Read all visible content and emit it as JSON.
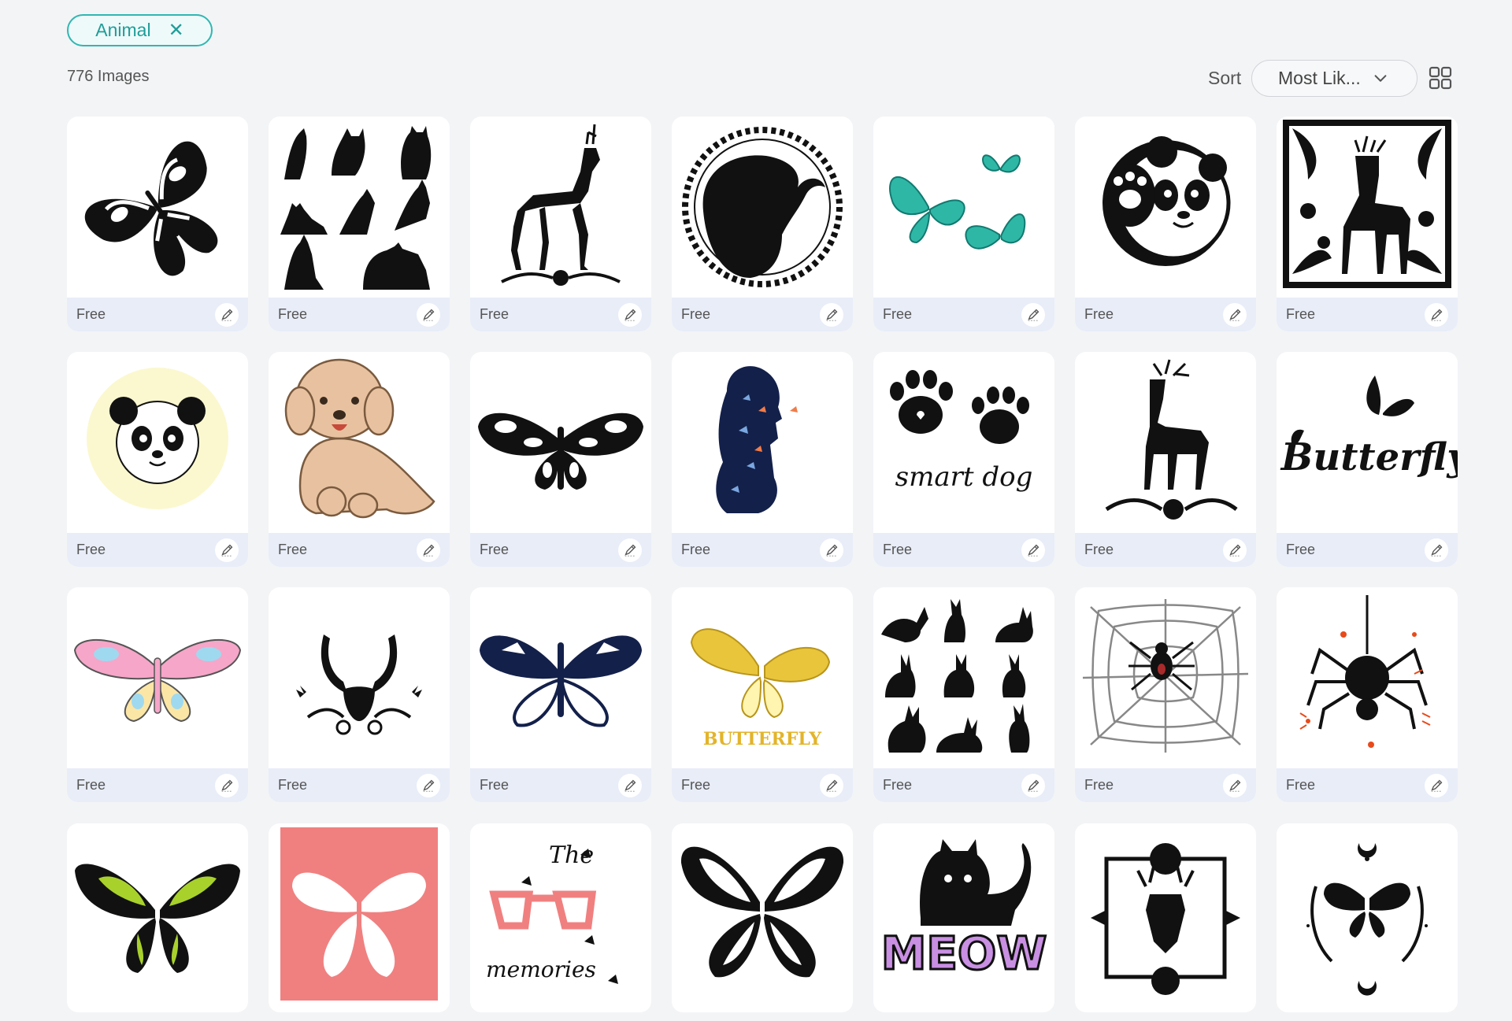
{
  "filter": {
    "tag_label": "Animal",
    "close_glyph": "✕"
  },
  "results": {
    "count_text": "776 Images"
  },
  "sort": {
    "label": "Sort",
    "selected": "Most Lik..."
  },
  "icons": {
    "grid_view": "grid-view-icon",
    "edit": "pencil-icon",
    "chevron": "chevron-down-icon"
  },
  "card_label": "Free",
  "cards": [
    {
      "subject": "butterfly"
    },
    {
      "subject": "cats"
    },
    {
      "subject": "deer"
    },
    {
      "subject": "elephant-wreath"
    },
    {
      "subject": "teal-butterflies"
    },
    {
      "subject": "panda-waving"
    },
    {
      "subject": "deer-frame"
    },
    {
      "subject": "panda-circle"
    },
    {
      "subject": "poodle"
    },
    {
      "subject": "butterfly"
    },
    {
      "subject": "woman-butterflies"
    },
    {
      "subject": "paws"
    },
    {
      "subject": "deer-flowers"
    },
    {
      "subject": "butterfly-script"
    },
    {
      "subject": "pink-butterfly"
    },
    {
      "subject": "antlers-flowers"
    },
    {
      "subject": "navy-butterfly"
    },
    {
      "subject": "yellow-butterfly"
    },
    {
      "subject": "rabbits"
    },
    {
      "subject": "spider-web"
    },
    {
      "subject": "spider"
    },
    {
      "subject": "green-butterfly"
    },
    {
      "subject": "pink-butterfly-card"
    },
    {
      "subject": "glasses-memories"
    },
    {
      "subject": "black-butterfly"
    },
    {
      "subject": "meow-cat"
    },
    {
      "subject": "deer-rose-frame"
    },
    {
      "subject": "moon-butterfly"
    }
  ],
  "texts": {
    "smart_dog": "smart dog",
    "butterfly_script": "Butterfly",
    "butterfly_caps": "BUTTERFLY",
    "the": "The",
    "memories": "memories",
    "meow": "MEOW"
  },
  "colors": {
    "accent": "#2fb7b2",
    "footer": "#e8edf8",
    "teal": "#2fb7a6",
    "navy": "#13204a",
    "pink": "#f08080",
    "butterfly_pink": "#f6a6c8",
    "yellow": "#e9c53c",
    "lime": "#a8d12c",
    "purple": "#c98fe3",
    "moon_bg": "#fbf8cf"
  }
}
